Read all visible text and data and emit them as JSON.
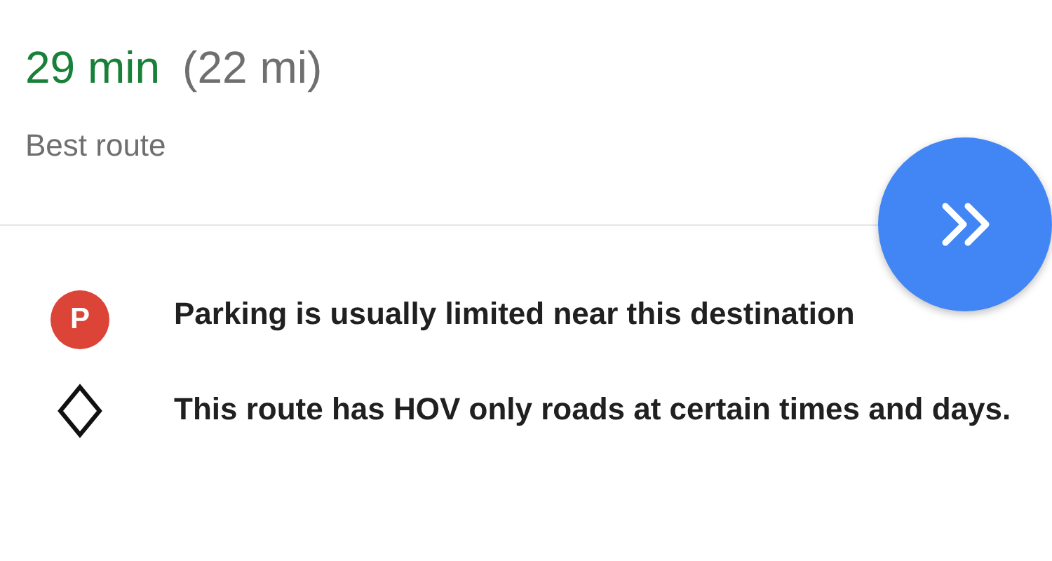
{
  "header": {
    "duration": "29 min",
    "distance": "(22 mi)",
    "route_label": "Best route"
  },
  "notices": [
    {
      "kind": "parking",
      "icon_text": "P",
      "text": "Parking is usually limited near this destination"
    },
    {
      "kind": "hov",
      "text": "This route has HOV only roads at certain times and days."
    }
  ]
}
